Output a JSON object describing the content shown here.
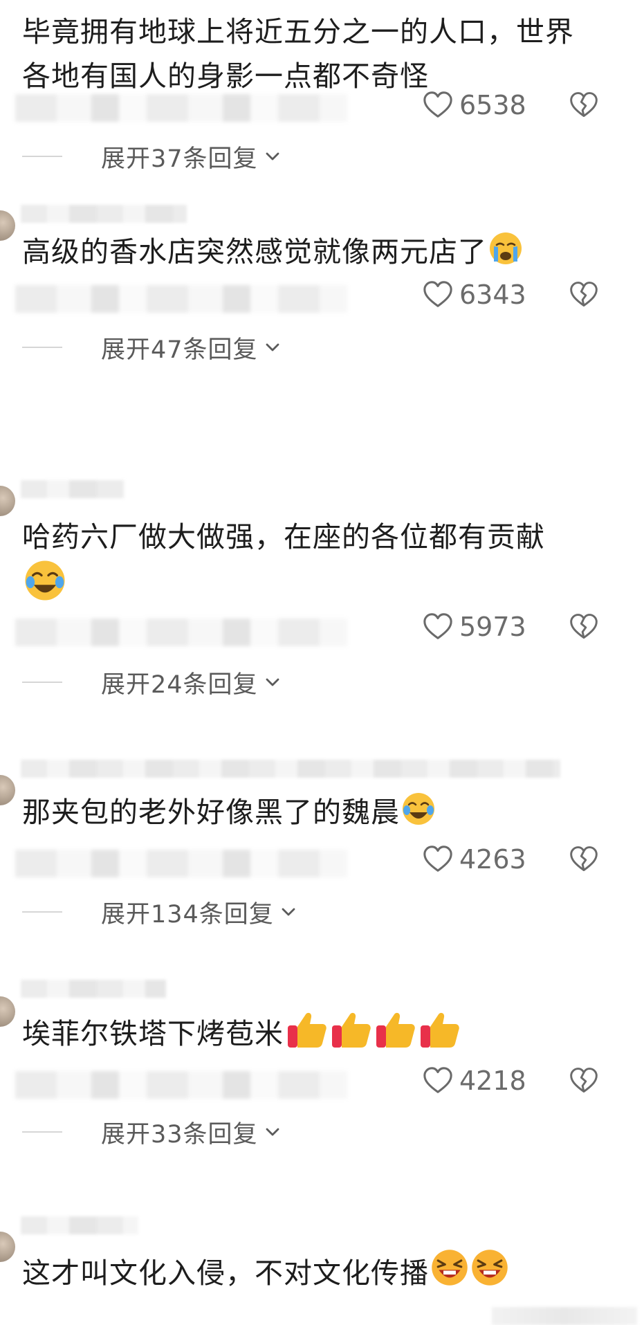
{
  "comments": [
    {
      "text": "毕竟拥有地球上将近五分之一的人口，世界各地有国人的身影一点都不奇怪",
      "likes": "6538",
      "expand": "展开37条回复"
    },
    {
      "text": "高级的香水店突然感觉就像两元店了",
      "emoji": "crying-face",
      "likes": "6343",
      "expand": "展开47条回复"
    },
    {
      "text": "哈药六厂做大做强，在座的各位都有贡献",
      "emoji": "tears-of-joy-face",
      "likes": "5973",
      "expand": "展开24条回复"
    },
    {
      "text": "那夹包的老外好像黑了的魏晨",
      "emoji": "tears-of-joy-face",
      "likes": "4263",
      "expand": "展开134条回复"
    },
    {
      "text": "埃菲尔铁塔下烤苞米",
      "emoji": "thumbs-up x4",
      "likes": "4218",
      "expand": "展开33条回复"
    },
    {
      "text": "这才叫文化入侵，不对文化传播",
      "emoji": "laughing-face x2"
    }
  ],
  "colors": {
    "text": "#1d1d1d",
    "count": "#6b6b6b",
    "expand": "#5a5a5a"
  }
}
